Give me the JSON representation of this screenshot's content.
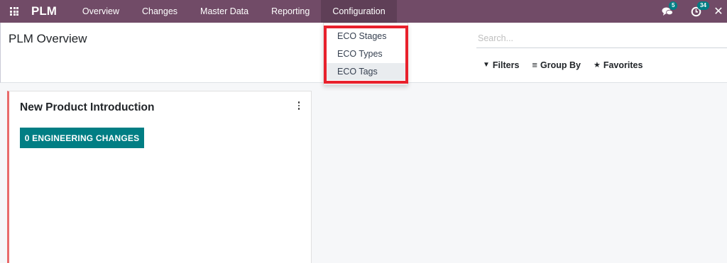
{
  "navbar": {
    "app_icon": "apps-grid-icon",
    "brand": "PLM",
    "items": [
      {
        "label": "Overview"
      },
      {
        "label": "Changes"
      },
      {
        "label": "Master Data"
      },
      {
        "label": "Reporting"
      },
      {
        "label": "Configuration",
        "active": true
      }
    ],
    "messages_icon": "chat-bubbles-icon",
    "messages_count": "5",
    "activities_icon": "clock-icon",
    "activities_count": "34",
    "close_icon": "close-icon"
  },
  "control_panel": {
    "title": "PLM Overview",
    "search_placeholder": "Search...",
    "filters_label": "Filters",
    "group_by_label": "Group By",
    "favorites_label": "Favorites"
  },
  "config_dropdown": {
    "items": [
      {
        "label": "ECO Stages"
      },
      {
        "label": "ECO Types"
      },
      {
        "label": "ECO Tags",
        "hover": true
      }
    ],
    "highlight_color": "#e8212c"
  },
  "kanban": {
    "cards": [
      {
        "title": "New Product Introduction",
        "button_label": "0 ENGINEERING CHANGES",
        "accent_color": "#e96b6b"
      }
    ]
  },
  "colors": {
    "navbar_bg": "#714B67",
    "primary_button": "#017e84",
    "badge_bg": "#017e84"
  }
}
